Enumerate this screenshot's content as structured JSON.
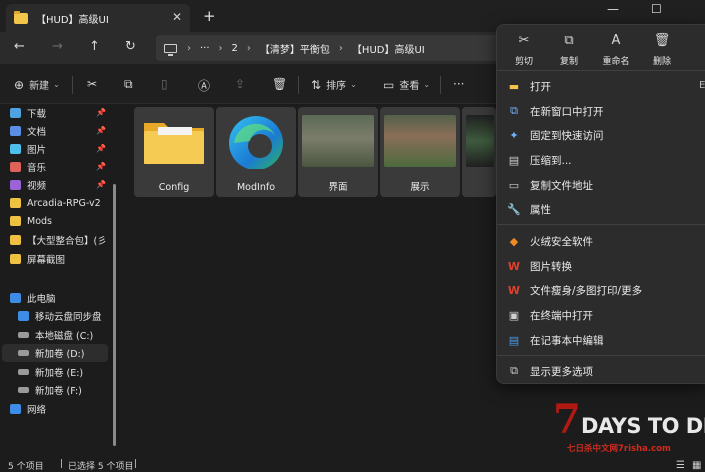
{
  "window": {
    "tab_title": "【HUD】高级UI",
    "tab_close": "✕",
    "tab_add": "+",
    "minimize": "—",
    "maximize": "☐"
  },
  "nav": {
    "back": "←",
    "forward": "→",
    "up": "↑",
    "refresh": "↻",
    "breadcrumb": [
      "2",
      "【清梦】平衡包",
      "【HUD】高级UI"
    ],
    "more": "···",
    "sep": "›"
  },
  "toolbar": {
    "new_label": "新建",
    "sort_label": "排序",
    "view_label": "查看",
    "more": "···"
  },
  "sidebar": {
    "quick": [
      {
        "label": "下载",
        "color": "#4fa3e0"
      },
      {
        "label": "文档",
        "color": "#5b8ee6"
      },
      {
        "label": "图片",
        "color": "#4cc0e8"
      },
      {
        "label": "音乐",
        "color": "#e0605a"
      },
      {
        "label": "视频",
        "color": "#9a64d8"
      },
      {
        "label": "Arcadia-RPG-v2",
        "color": "#f0c040"
      },
      {
        "label": "Mods",
        "color": "#f0c040"
      },
      {
        "label": "【大型整合包】(彡",
        "color": "#f0c040"
      },
      {
        "label": "屏幕截图",
        "color": "#f0c040"
      }
    ],
    "pc": "此电脑",
    "drives": [
      {
        "label": "移动云盘同步盘",
        "color": "#3d8ce6"
      },
      {
        "label": "本地磁盘 (C:)",
        "color": "#9a9a9a"
      },
      {
        "label": "新加卷 (D:)",
        "color": "#9a9a9a"
      },
      {
        "label": "新加卷 (E:)",
        "color": "#9a9a9a"
      },
      {
        "label": "新加卷 (F:)",
        "color": "#9a9a9a"
      }
    ],
    "network": "网络"
  },
  "files": [
    {
      "name": "Config"
    },
    {
      "name": "ModInfo"
    },
    {
      "name": "界面"
    },
    {
      "name": "展示"
    },
    {
      "name": ""
    }
  ],
  "status": {
    "count": "5 个项目",
    "selected": "已选择 5 个项目"
  },
  "context_menu": {
    "quick": [
      {
        "label": "剪切",
        "icon": "✂"
      },
      {
        "label": "复制",
        "icon": "⧉"
      },
      {
        "label": "重命名",
        "icon": "A"
      },
      {
        "label": "删除",
        "icon": "🗑"
      }
    ],
    "items": [
      {
        "label": "打开",
        "icon": "▬",
        "color": "#f3c54b",
        "shortcut": "E"
      },
      {
        "label": "在新窗口中打开",
        "icon": "⧉",
        "color": "#6fb3ff"
      },
      {
        "label": "固定到快速访问",
        "icon": "✦",
        "color": "#6fb3ff"
      },
      {
        "label": "压缩到...",
        "icon": "▤",
        "color": "#cfcfcf"
      },
      {
        "label": "复制文件地址",
        "icon": "▭",
        "color": "#cfcfcf"
      },
      {
        "label": "属性",
        "icon": "🔧",
        "color": "#cfcfcf"
      },
      {
        "label": "火绒安全软件",
        "icon": "◆",
        "color": "#f08a24"
      },
      {
        "label": "图片转换",
        "icon": "W",
        "color": "#e0402e"
      },
      {
        "label": "文件瘦身/多图打印/更多",
        "icon": "W",
        "color": "#e0402e"
      },
      {
        "label": "在终端中打开",
        "icon": "▣",
        "color": "#cfcfcf"
      },
      {
        "label": "在记事本中编辑",
        "icon": "▤",
        "color": "#4c9be8"
      },
      {
        "label": "显示更多选项",
        "icon": "⧉",
        "color": "#cfcfcf"
      }
    ]
  },
  "watermark": {
    "seven": "7",
    "days": "DAYS TO DIE",
    "site": "七日杀中文网7risha.com"
  }
}
